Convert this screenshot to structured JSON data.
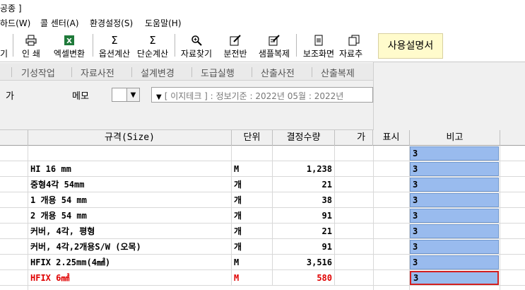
{
  "window": {
    "title_fragment": "공종 ]"
  },
  "menu": [
    "하드(W)",
    "콜 센터(A)",
    "환경설정(S)",
    "도움말(H)"
  ],
  "toolbar": {
    "partial_label": "기",
    "items": [
      {
        "label": "인 쇄",
        "icon": "printer-icon"
      },
      {
        "label": "엑셀변환",
        "icon": "excel-icon"
      },
      {
        "label": "옵션계산",
        "icon": "sigma-icon"
      },
      {
        "label": "단순계산",
        "icon": "sigma-icon"
      },
      {
        "label": "자료찾기",
        "icon": "magnifier-icon"
      },
      {
        "label": "분전반",
        "icon": "edit-icon"
      },
      {
        "label": "샘플복제",
        "icon": "edit-icon"
      },
      {
        "label": "보조화면",
        "icon": "document-icon"
      },
      {
        "label": "자료추",
        "icon": "copy-icon"
      }
    ],
    "help_label": "사용설명서"
  },
  "tabs": [
    "기성작업",
    "자료사전",
    "설계변경",
    "도급실행",
    "산출사전",
    "산출복제"
  ],
  "filter": {
    "left_label": "가",
    "memo_label": "메모",
    "info_text": "[ 이지테크 ] : 정보기준 : 2022년 05월 : 2022년"
  },
  "grid": {
    "headers": {
      "spec": "규격(Size)",
      "unit": "단위",
      "qty": "결정수량",
      "partial": "가",
      "display": "표시",
      "remark": "비고"
    },
    "rows": [
      {
        "spec": "",
        "unit": "",
        "qty": "",
        "remark": "3",
        "red": false,
        "selected": false
      },
      {
        "spec": "HI 16 mm",
        "unit": "M",
        "qty": "1,238",
        "remark": "3",
        "red": false,
        "selected": false
      },
      {
        "spec": "중형4각 54mm",
        "unit": "개",
        "qty": "21",
        "remark": "3",
        "red": false,
        "selected": false
      },
      {
        "spec": "1 개용 54 mm",
        "unit": "개",
        "qty": "38",
        "remark": "3",
        "red": false,
        "selected": false
      },
      {
        "spec": "2 개용 54 mm",
        "unit": "개",
        "qty": "91",
        "remark": "3",
        "red": false,
        "selected": false
      },
      {
        "spec": "커버, 4각, 평형",
        "unit": "개",
        "qty": "21",
        "remark": "3",
        "red": false,
        "selected": false
      },
      {
        "spec": "커버, 4각,2개용S/W (오목)",
        "unit": "개",
        "qty": "91",
        "remark": "3",
        "red": false,
        "selected": false
      },
      {
        "spec": "HFIX 2.25mm(4㎟)",
        "unit": "M",
        "qty": "3,516",
        "remark": "3",
        "red": false,
        "selected": false
      },
      {
        "spec": "HFIX 6㎟",
        "unit": "M",
        "qty": "580",
        "remark": "3",
        "red": true,
        "selected": true
      }
    ]
  },
  "colors": {
    "accent_blue": "#99bbee",
    "selection_red": "#d22020",
    "red_text": "#e00000",
    "help_bg": "#fffbcc"
  }
}
